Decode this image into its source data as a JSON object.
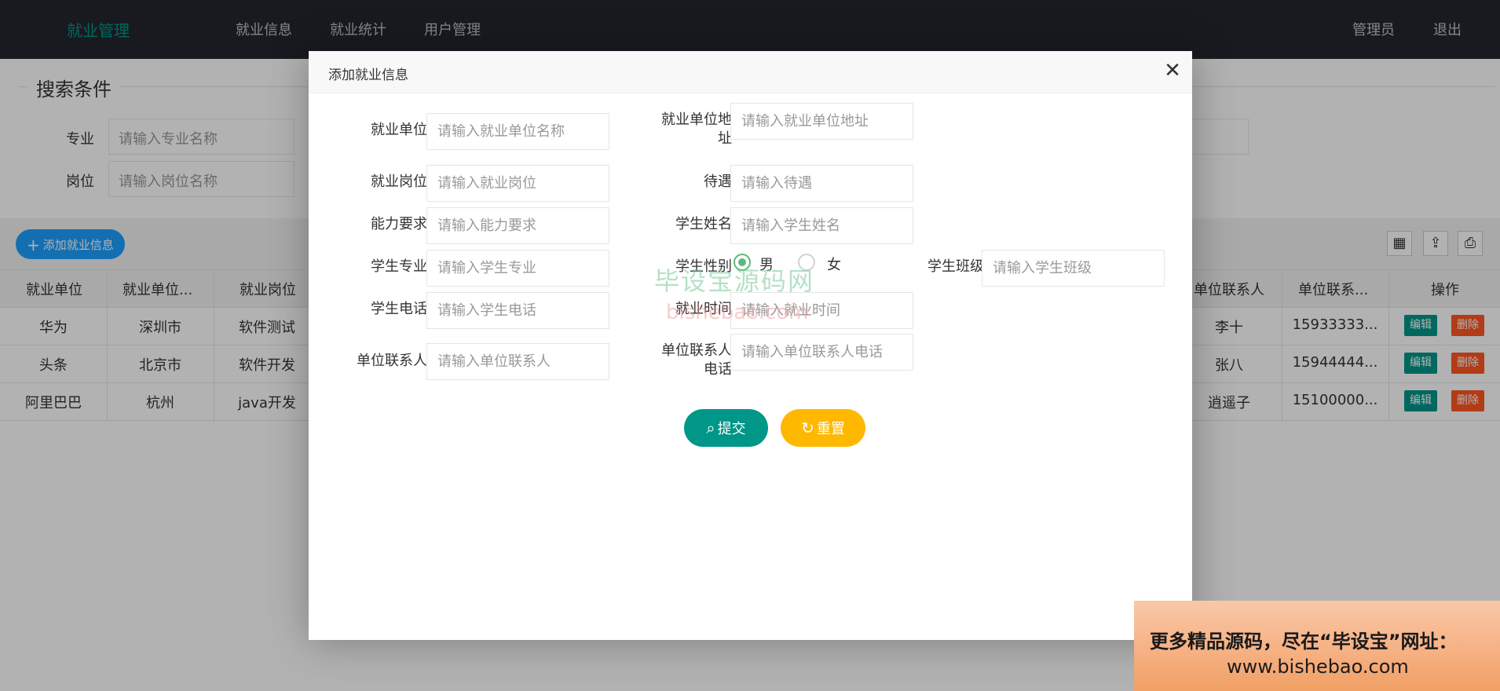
{
  "header": {
    "logo": "就业管理",
    "nav": [
      "就业信息",
      "就业统计",
      "用户管理"
    ],
    "user": "管理员",
    "logout": "退出"
  },
  "search": {
    "legend": "搜索条件",
    "fields": [
      {
        "label": "专业",
        "placeholder": "请输入专业名称"
      },
      {
        "label": "岗位",
        "placeholder": "请输入岗位名称"
      }
    ]
  },
  "toolbar": {
    "add_label": "添加就业信息",
    "icons": [
      "columns-icon",
      "export-icon",
      "print-icon"
    ]
  },
  "table": {
    "headers": [
      "就业单位",
      "就业单位...",
      "就业岗位",
      "单位联系人",
      "单位联系...",
      "操作"
    ],
    "rows": [
      {
        "company": "华为",
        "address": "深圳市",
        "position": "软件测试",
        "contact": "李十",
        "phone": "15933333..."
      },
      {
        "company": "头条",
        "address": "北京市",
        "position": "软件开发",
        "contact": "张八",
        "phone": "15944444..."
      },
      {
        "company": "阿里巴巴",
        "address": "杭州",
        "position": "java开发",
        "contact": "逍遥子",
        "phone": "15100000..."
      }
    ],
    "edit_label": "编辑",
    "delete_label": "删除"
  },
  "modal": {
    "title": "添加就业信息",
    "close": "✕",
    "fields": {
      "company": {
        "label": "就业单位",
        "placeholder": "请输入就业单位名称"
      },
      "address": {
        "label1": "就业单位地",
        "label2": "址",
        "placeholder": "请输入就业单位地址"
      },
      "position": {
        "label": "就业岗位",
        "placeholder": "请输入就业岗位"
      },
      "salary": {
        "label": "待遇",
        "placeholder": "请输入待遇"
      },
      "ability": {
        "label": "能力要求",
        "placeholder": "请输入能力要求"
      },
      "student_name": {
        "label": "学生姓名",
        "placeholder": "请输入学生姓名"
      },
      "major": {
        "label": "学生专业",
        "placeholder": "请输入学生专业"
      },
      "gender": {
        "label": "学生性别",
        "options": [
          "男",
          "女"
        ],
        "selected": "男"
      },
      "class": {
        "label": "学生班级",
        "placeholder": "请输入学生班级"
      },
      "phone": {
        "label": "学生电话",
        "placeholder": "请输入学生电话"
      },
      "employ_time": {
        "label": "就业时间",
        "placeholder": "请输入就业时间"
      },
      "contact": {
        "label": "单位联系人",
        "placeholder": "请输入单位联系人"
      },
      "contact_phone": {
        "label1": "单位联系人",
        "label2": "电话",
        "placeholder": "请输入单位联系人电话"
      }
    },
    "submit_label": "提交",
    "reset_label": "重置",
    "watermark1": "毕设宝源码网",
    "watermark2": "bishebao.com"
  },
  "promo": {
    "line1": "更多精品源码，尽在“毕设宝”网址：",
    "line2": "www.bishebao.com"
  },
  "colors": {
    "header_bg": "#23262e",
    "primary": "#009688",
    "blue": "#1e9fff",
    "danger": "#ff5722",
    "warn": "#ffb800"
  }
}
